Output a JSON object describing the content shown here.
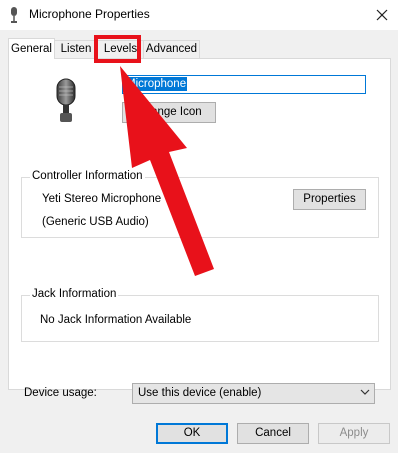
{
  "window": {
    "title": "Microphone Properties"
  },
  "tabs": [
    {
      "label": "General"
    },
    {
      "label": "Listen"
    },
    {
      "label": "Levels"
    },
    {
      "label": "Advanced"
    }
  ],
  "general": {
    "device_name": "Microphone",
    "change_icon_label": "Change Icon"
  },
  "controller": {
    "group_label": "Controller Information",
    "line1": "Yeti Stereo Microphone",
    "line2": "(Generic USB Audio)",
    "properties_label": "Properties"
  },
  "jack": {
    "group_label": "Jack Information",
    "text": "No Jack Information Available"
  },
  "device_usage": {
    "label": "Device usage:",
    "selected": "Use this device (enable)"
  },
  "footer": {
    "ok": "OK",
    "cancel": "Cancel",
    "apply": "Apply"
  },
  "colors": {
    "annotation": "#e8111a",
    "accent": "#0078d7"
  }
}
